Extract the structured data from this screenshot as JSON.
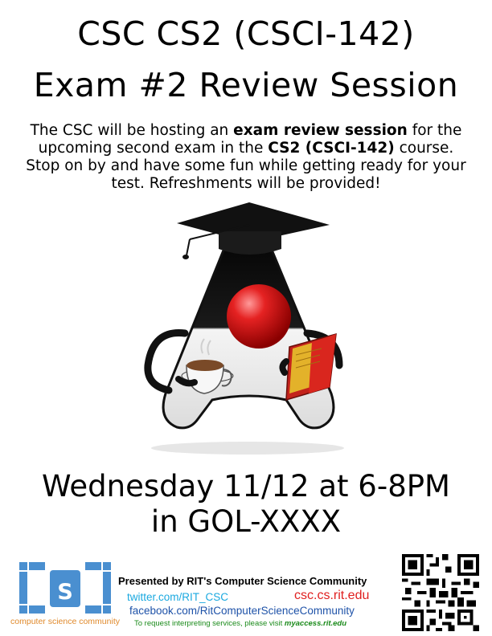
{
  "title": {
    "line1": "CSC CS2 (CSCI-142)",
    "line2": "Exam #2 Review Session"
  },
  "blurb": {
    "p1": "The CSC will be hosting an ",
    "b1": "exam review session",
    "p2": " for the upcoming second exam in the ",
    "b2": "CS2 (CSCI-142)",
    "p3": " course. Stop on by and have some fun while getting ready for your test. Refreshments will be provided!"
  },
  "event": {
    "when": "Wednesday 11/12 at 6-8PM",
    "where": "in GOL-XXXX"
  },
  "footer": {
    "logo_letter": "s",
    "logo_text": "computer science community",
    "presented_by": "Presented by RIT's Computer Science Community",
    "twitter": "twitter.com/RIT_CSC",
    "website": "csc.cs.rit.edu",
    "facebook": "facebook.com/RitComputerScienceCommunity",
    "interpreting_prefix": "To request interpreting services, please visit ",
    "interpreting_link": "myaccess.rit.edu"
  },
  "colors": {
    "logo_blue": "#4a8fd0",
    "logo_orange": "#e08a2c",
    "twitter": "#1aa9e0",
    "website": "#e01f1f",
    "facebook": "#1e52a8",
    "interpreting": "#1a8a1a",
    "mascot_nose": "#d81b1b"
  },
  "icons": {
    "mascot": "java-duke-graduate-icon",
    "logo": "csc-logo-icon",
    "qr": "qr-code-icon"
  }
}
